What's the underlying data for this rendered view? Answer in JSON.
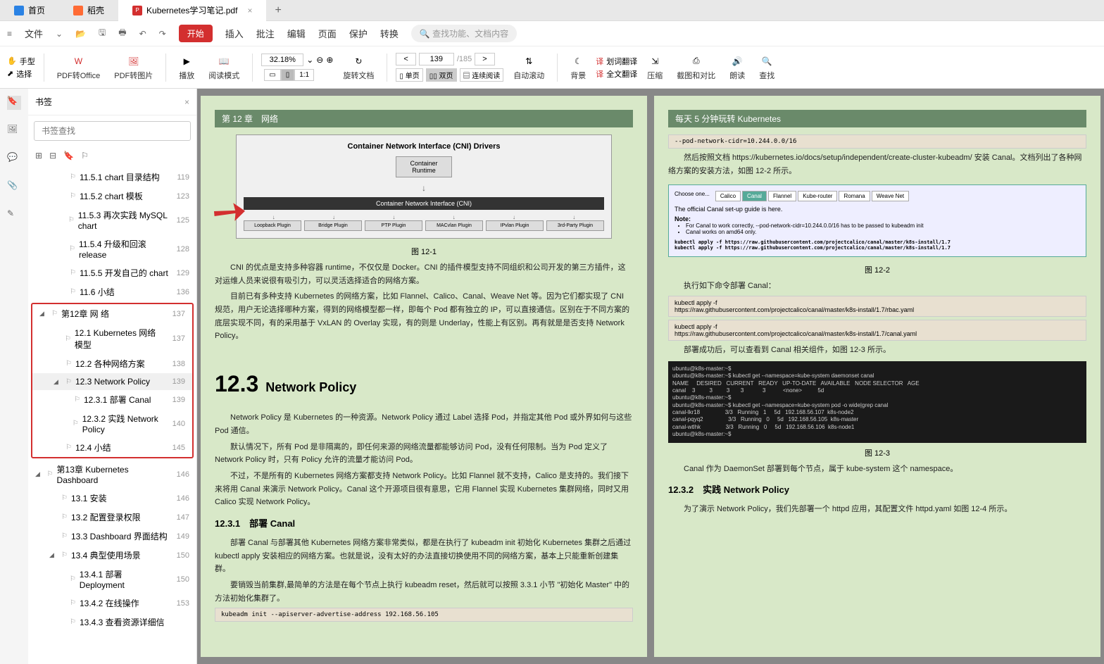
{
  "tabs": {
    "home": "首页",
    "daoke": "稻壳",
    "pdf_file": "Kubernetes学习笔记.pdf"
  },
  "menu": {
    "file": "文件",
    "start": "开始",
    "insert": "插入",
    "comment": "批注",
    "edit": "编辑",
    "page": "页面",
    "protect": "保护",
    "convert": "转换",
    "search_placeholder": "查找功能、文档内容"
  },
  "toolbar": {
    "hand": "手型",
    "select": "选择",
    "pdf_to_office": "PDF转Office",
    "pdf_to_image": "PDF转图片",
    "play": "播放",
    "read_mode": "阅读模式",
    "zoom": "32.18%",
    "rotate": "旋转文档",
    "single": "单页",
    "double": "双页",
    "continuous": "连续阅读",
    "auto_scroll": "自动滚动",
    "page_current": "139",
    "page_total": "/185",
    "background": "背景",
    "word_translate": "划词翻译",
    "full_translate": "全文翻译",
    "compress": "压缩",
    "screenshot": "截图和对比",
    "read_aloud": "朗读",
    "find": "查找"
  },
  "sidebar": {
    "title": "书签",
    "search_placeholder": "书签查找",
    "items": [
      {
        "text": "11.5.1 chart 目录结构",
        "page": "119",
        "indent": 2
      },
      {
        "text": "11.5.2 chart 模板",
        "page": "123",
        "indent": 2
      },
      {
        "text": "11.5.3 再次实践 MySQL chart",
        "page": "125",
        "indent": 2
      },
      {
        "text": "11.5.4 升级和回滚 release",
        "page": "128",
        "indent": 2
      },
      {
        "text": "11.5.5 开发自己的 chart",
        "page": "129",
        "indent": 2
      },
      {
        "text": "11.6 小结",
        "page": "136",
        "indent": 2
      },
      {
        "text": "第12章 网 络",
        "page": "137",
        "indent": 0,
        "toggle": true,
        "boxstart": true
      },
      {
        "text": "12.1 Kubernetes 网络模型",
        "page": "137",
        "indent": 1
      },
      {
        "text": "12.2 各种网络方案",
        "page": "138",
        "indent": 1
      },
      {
        "text": "12.3 Network Policy",
        "page": "139",
        "indent": 1,
        "toggle": true,
        "highlight": true
      },
      {
        "text": "12.3.1 部署 Canal",
        "page": "139",
        "indent": 2
      },
      {
        "text": "12.3.2 实践 Network Policy",
        "page": "140",
        "indent": 2
      },
      {
        "text": "12.4 小结",
        "page": "145",
        "indent": 1,
        "boxend": true
      },
      {
        "text": "第13章 Kubernetes Dashboard",
        "page": "146",
        "indent": 0,
        "toggle": true
      },
      {
        "text": "13.1 安装",
        "page": "146",
        "indent": 1
      },
      {
        "text": "13.2 配置登录权限",
        "page": "147",
        "indent": 1
      },
      {
        "text": "13.3 Dashboard 界面结构",
        "page": "149",
        "indent": 1
      },
      {
        "text": "13.4 典型使用场景",
        "page": "150",
        "indent": 1,
        "toggle": true
      },
      {
        "text": "13.4.1 部署 Deployment",
        "page": "150",
        "indent": 2
      },
      {
        "text": "13.4.2 在线操作",
        "page": "153",
        "indent": 2
      },
      {
        "text": "13.4.3 查看资源详细信",
        "page": "",
        "indent": 2
      }
    ]
  },
  "page_left": {
    "header": "第 12 章　网络",
    "cni": {
      "title": "Container Network Interface (CNI) Drivers",
      "runtime": "Container Runtime",
      "interface": "Container Network Interface (CNI)",
      "plugins": [
        "Loopback Plugin",
        "Bridge Plugin",
        "PTP Plugin",
        "MACvlan Plugin",
        "IPvlan Plugin",
        "3rd-Party Plugin"
      ]
    },
    "fig1": "图 12-1",
    "p1": "CNI 的优点是支持多种容器 runtime，不仅仅是 Docker。CNI 的插件模型支持不同组织和公司开发的第三方插件，这对运维人员来说很有吸引力，可以灵活选择适合的网络方案。",
    "p2": "目前已有多种支持 Kubernetes 的网络方案，比如 Flannel、Calico、Canal、Weave Net 等。因为它们都实现了 CNI 规范，用户无论选择哪种方案，得到的网络模型都一样，即每个 Pod 都有独立的 IP，可以直接通信。区别在于不同方案的底层实现不同，有的采用基于 VxLAN 的 Overlay 实现，有的则是 Underlay，性能上有区别。再有就是是否支持 Network Policy。",
    "section_num": "12.3",
    "section_title": "Network Policy",
    "p3": "Network Policy 是 Kubernetes 的一种资源。Network Policy 通过 Label 选择 Pod，并指定其他 Pod 或外界如何与这些 Pod 通信。",
    "p4": "默认情况下，所有 Pod 是非隔离的，即任何来源的网络流量都能够访问 Pod，没有任何限制。当为 Pod 定义了 Network Policy 时，只有 Policy 允许的流量才能访问 Pod。",
    "p5": "不过，不是所有的 Kubernetes 网络方案都支持 Network Policy。比如 Flannel 就不支持，Calico 是支持的。我们接下来将用 Canal 来演示 Network Policy。Canal 这个开源项目很有意思，它用 Flannel 实现 Kubernetes 集群网络，同时又用 Calico 实现 Network Policy。",
    "sub1": "12.3.1　部署 Canal",
    "p6": "部署 Canal 与部署其他 Kubernetes 网络方案非常类似，都是在执行了 kubeadm init 初始化 Kubernetes 集群之后通过 kubectl apply 安装相应的网络方案。也就是说，没有太好的办法直接切换使用不同的网络方案，基本上只能重新创建集群。",
    "p7": "要销毁当前集群,最简单的方法是在每个节点上执行 kubeadm reset，然后就可以按照 3.3.1 小节 \"初始化 Master\" 中的方法初始化集群了。",
    "code1": "kubeadm init --apiserver-advertise-address 192.168.56.105"
  },
  "page_right": {
    "header": "每天 5 分钟玩转 Kubernetes",
    "code_top": "--pod-network-cidr=10.244.0.0/16",
    "p1": "然后按照文档 https://kubernetes.io/docs/setup/independent/create-cluster-kubeadm/ 安装 Canal。文档列出了各种网络方案的安装方法，如图 12-2 所示。",
    "options": {
      "header": "Choose one...",
      "tabs": [
        "Calico",
        "Canal",
        "Flannel",
        "Kube-router",
        "Romana",
        "Weave Net"
      ],
      "text1": "The official Canal set-up guide is here.",
      "note": "Note:",
      "bullet1": "For Canal to work correctly, --pod-network-cidr=10.244.0.0/16 has to be passed to kubeadm init",
      "bullet2": "Canal works on amd64 only.",
      "cmd1": "kubectl apply -f https://raw.githubusercontent.com/projectcalico/canal/master/k8s-install/1.7",
      "cmd2": "kubectl apply -f https://raw.githubusercontent.com/projectcalico/canal/master/k8s-install/1.7"
    },
    "fig2": "图 12-2",
    "p2": "执行如下命令部署 Canal：",
    "cmd3": "kubectl apply -f",
    "cmd3b": "https://raw.githubusercontent.com/projectcalico/canal/master/k8s-install/1.7/rbac.yaml",
    "cmd4": "kubectl apply -f",
    "cmd4b": "https://raw.githubusercontent.com/projectcalico/canal/master/k8s-install/1.7/canal.yaml",
    "p3": "部署成功后，可以查看到 Canal 相关组件，如图 12-3 所示。",
    "terminal": {
      "l1": "ubuntu@k8s-master:~$",
      "l2": "ubuntu@k8s-master:~$ kubectl get --namespace=kube-system daemonset canal",
      "l3": "NAME     DESIRED   CURRENT   READY   UP-TO-DATE   AVAILABLE   NODE SELECTOR   AGE",
      "l4": "canal    3         3         3       3            3           <none>          5d",
      "l5": "ubuntu@k8s-master:~$",
      "l6": "ubuntu@k8s-master:~$ kubectl get --namespace=kube-system pod -o wide|grep canal",
      "l7": "canal-lkr18                3/3   Running   1     5d   192.168.56.107  k8s-node2",
      "l8": "canal-pqyq2                3/3   Running   0     5d   192.168.56.105  k8s-master",
      "l9": "canal-wtlhk                3/3   Running   0     5d   192.168.56.106  k8s-node1",
      "l10": "ubuntu@k8s-master:~$"
    },
    "fig3": "图 12-3",
    "p4": "Canal 作为 DaemonSet 部署到每个节点，属于 kube-system 这个 namespace。",
    "sub2": "12.3.2　实践 Network Policy",
    "p5": "为了演示 Network Policy，我们先部署一个 httpd 应用，其配置文件 httpd.yaml 如图 12-4 所示。"
  }
}
